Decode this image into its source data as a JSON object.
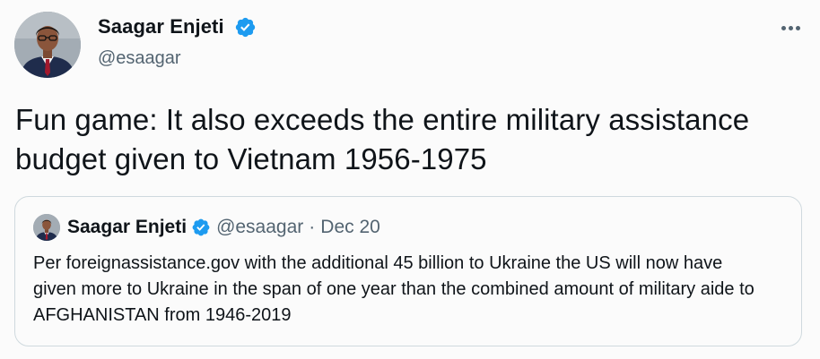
{
  "tweet": {
    "author": {
      "display_name": "Saagar Enjeti",
      "handle": "@esaagar",
      "verified": true
    },
    "text": "Fun game: It also exceeds the entire military assistance budget given to Vietnam 1956-1975",
    "more_icon": "more-horizontal-icon"
  },
  "quoted_tweet": {
    "author": {
      "display_name": "Saagar Enjeti",
      "handle": "@esaagar",
      "verified": true
    },
    "separator": "·",
    "date": "Dec 20",
    "text": "Per foreignassistance.gov with the additional 45 billion to Ukraine the US will now have given more to Ukraine in the span of one year than the combined amount of military aide to AFGHANISTAN from 1946-2019"
  },
  "colors": {
    "background": "#fbfbfb",
    "text_primary": "#0f1419",
    "text_secondary": "#536471",
    "verified_blue": "#1d9bf0",
    "card_border": "#cfd9de"
  }
}
